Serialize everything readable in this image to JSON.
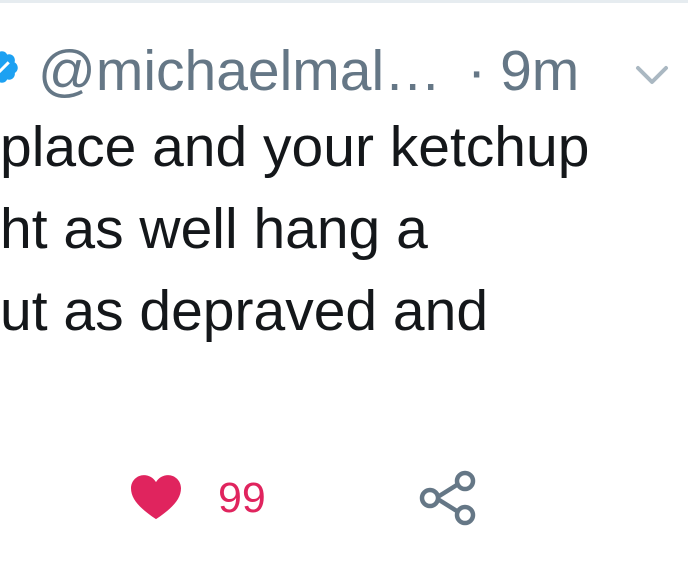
{
  "tweet": {
    "handle": "@michaelmal…",
    "separator": "·",
    "timestamp": "9m",
    "text_lines": [
      "place and your ketchup",
      "ht as well hang a",
      "ut as depraved and"
    ]
  },
  "actions": {
    "like_count": "99"
  },
  "colors": {
    "verified": "#1da1f2",
    "secondary_text": "#657786",
    "primary_text": "#14171a",
    "like": "#e0245e"
  },
  "icons": [
    "verified-badge-icon",
    "chevron-down-icon",
    "heart-icon",
    "share-icon"
  ]
}
